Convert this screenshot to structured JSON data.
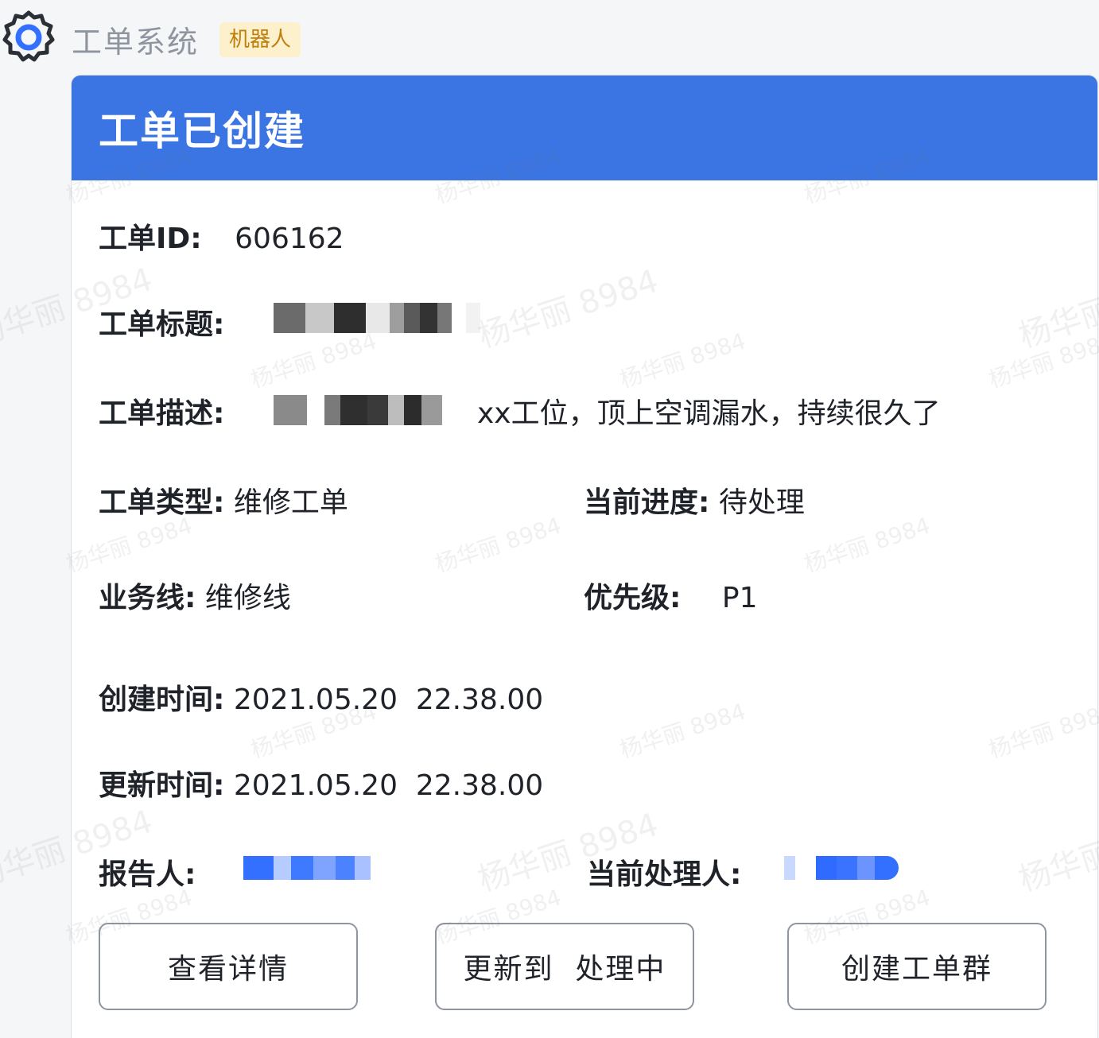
{
  "header": {
    "app_title": "工单系统",
    "badge": "机器人"
  },
  "card": {
    "title": "工单已创建",
    "fields": {
      "id_label": "工单ID:",
      "id_value": "606162",
      "title_label": "工单标题:",
      "desc_label": "工单描述:",
      "desc_value": "xx工位，顶上空调漏水，持续很久了",
      "type_label": "工单类型:",
      "type_value": "维修工单",
      "progress_label": "当前进度:",
      "progress_value": "待处理",
      "line_label": "业务线:",
      "line_value": "维修线",
      "priority_label": "优先级:",
      "priority_value": "P1",
      "created_label": "创建时间:",
      "created_value": "2021.05.20  22.38.00",
      "updated_label": "更新时间:",
      "updated_value": "2021.05.20  22.38.00",
      "reporter_label": "报告人:",
      "handler_label": "当前处理人:"
    },
    "buttons": {
      "view": "查看详情",
      "update": "更新到  处理中",
      "group": "创建工单群"
    }
  },
  "watermark": "杨华丽 8984",
  "colors": {
    "header_blue": "#3b74e3",
    "badge_bg": "#fdf0cc",
    "badge_text": "#c07f0b",
    "mention_blue": "#3370ff"
  }
}
